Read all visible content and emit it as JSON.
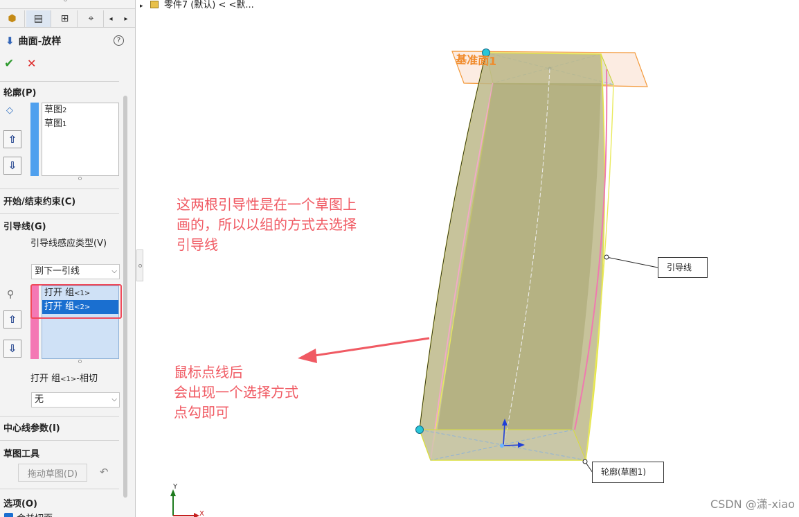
{
  "viewport": {
    "tree_header": "零件7 (默认) < <默...",
    "plane_label": "基准面1",
    "guide_callout": "引导线",
    "profile_callout": "轮廓(草图1)",
    "axis_x": "X",
    "axis_y": "Y",
    "annotation_1": [
      "这两根引导性是在一个草图上",
      "画的，所以以组的方式去选择",
      "引导线"
    ],
    "annotation_2": [
      "鼠标点线后",
      "会出现一个选择方式",
      "点勾即可"
    ],
    "watermark": "CSDN @潇-xiao"
  },
  "panel": {
    "title": "曲面-放样",
    "help": "?",
    "ok": "✔",
    "cancel": "✕",
    "profiles": {
      "title": "轮廓(P)",
      "items": [
        {
          "name": "草图",
          "num": "2"
        },
        {
          "name": "草图",
          "num": "1"
        }
      ]
    },
    "start_end": {
      "title": "开始/结束约束(C)"
    },
    "guides": {
      "title": "引导线(G)",
      "influence_label": "引导线感应类型(V)",
      "influence_value": "到下一引线",
      "items": [
        {
          "name": "打开 组",
          "tag": "<1>",
          "selected": false
        },
        {
          "name": "打开 组",
          "tag": "<2>",
          "selected": true
        }
      ],
      "tangency_label_main": "打开 组",
      "tangency_label_tag": "<1>",
      "tangency_label_suffix": "-相切",
      "tangency_value": "无"
    },
    "centerline": {
      "title": "中心线参数(I)"
    },
    "sketch_tools": {
      "title": "草图工具",
      "drag_button": "拖动草图(D)"
    },
    "options": {
      "title": "选项(O)",
      "checkbox_label": "合并切面"
    }
  },
  "colors": {
    "accent_blue": "#1a6fd0",
    "annotation_red": "#f05a63",
    "profile_blue": "#4fa0ee",
    "guide_pink": "#f478b4"
  }
}
